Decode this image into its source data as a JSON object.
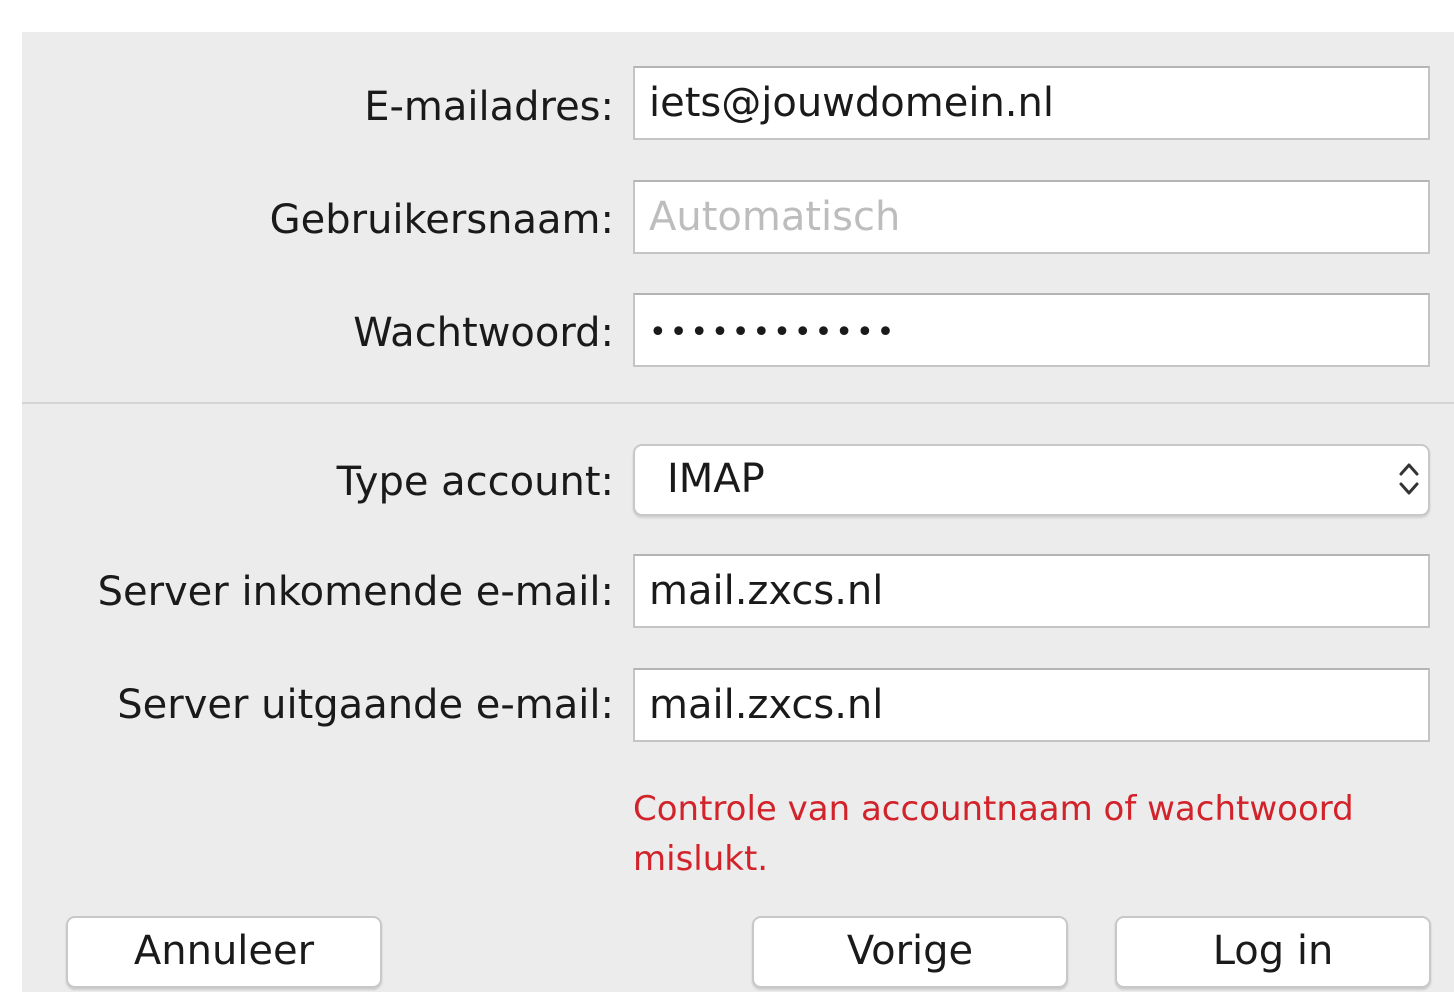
{
  "form": {
    "email_label": "E-mailadres:",
    "email_value": "iets@jouwdomein.nl",
    "username_label": "Gebruikersnaam:",
    "username_placeholder": "Automatisch",
    "password_label": "Wachtwoord:",
    "password_value": "••••••••••••",
    "account_type_label": "Type account:",
    "account_type_value": "IMAP",
    "incoming_label": "Server inkomende e-mail:",
    "incoming_value": "mail.zxcs.nl",
    "outgoing_label": "Server uitgaande e-mail:",
    "outgoing_value": "mail.zxcs.nl",
    "error_line1": "Controle van accountnaam of wachtwoord",
    "error_line2": "mislukt."
  },
  "buttons": {
    "cancel": "Annuleer",
    "previous": "Vorige",
    "login": "Log in"
  },
  "colors": {
    "background": "#ececec",
    "error": "#d2222a",
    "placeholder": "#bdbdbd"
  },
  "icons": {
    "select_stepper": "chevron-up-down-icon"
  }
}
